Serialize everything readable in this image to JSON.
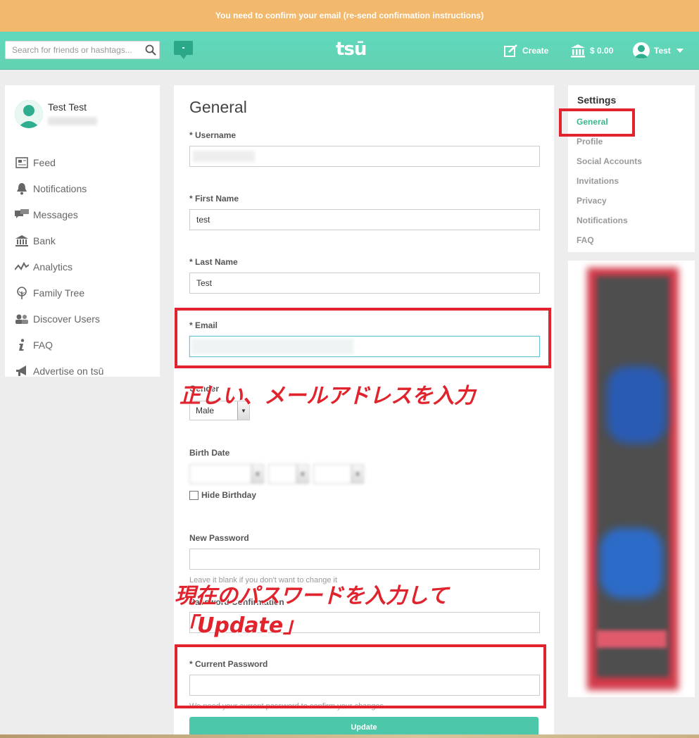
{
  "banner": {
    "text": "You need to confirm your email (re-send confirmation instructions)"
  },
  "topbar": {
    "search_placeholder": "Search for friends or hashtags...",
    "logo": "tsū",
    "create_label": "Create",
    "balance": "$ 0.00",
    "user_label": "Test"
  },
  "profile": {
    "name": "Test Test"
  },
  "sidebar": {
    "items": [
      {
        "label": "Feed",
        "icon": "newspaper-icon"
      },
      {
        "label": "Notifications",
        "icon": "bell-icon"
      },
      {
        "label": "Messages",
        "icon": "chat-bubbles-icon"
      },
      {
        "label": "Bank",
        "icon": "bank-icon"
      },
      {
        "label": "Analytics",
        "icon": "analytics-icon"
      },
      {
        "label": "Family Tree",
        "icon": "tree-icon"
      },
      {
        "label": "Discover Users",
        "icon": "users-icon"
      },
      {
        "label": "FAQ",
        "icon": "info-icon"
      },
      {
        "label": "Advertise on tsū",
        "icon": "megaphone-icon"
      }
    ]
  },
  "form": {
    "title": "General",
    "username_label": "* Username",
    "firstname_label": "* First Name",
    "firstname_value": "test",
    "lastname_label": "* Last Name",
    "lastname_value": "Test",
    "email_label": "* Email",
    "gender_label": "Gender",
    "gender_value": "Male",
    "birthdate_label": "Birth Date",
    "hide_birthday_label": "Hide Birthday",
    "new_password_label": "New Password",
    "new_password_hint": "Leave it blank if you don't want to change it",
    "password_confirm_label": "Password Confirmation",
    "current_password_label": "* Current Password",
    "current_password_hint": "We need your current password to confirm your changes",
    "update_label": "Update"
  },
  "settings": {
    "title": "Settings",
    "items": [
      "General",
      "Profile",
      "Social Accounts",
      "Invitations",
      "Privacy",
      "Notifications",
      "FAQ"
    ],
    "active": "General"
  },
  "annotations": {
    "email_note": "正しい、メールアドレスを入力",
    "password_note_line1": "現在のパスワードを入力して",
    "password_note_line2": "「Update」"
  },
  "colors": {
    "banner": "#f2b86c",
    "topbar": "#5fd8bd",
    "accent": "#4cc7a9",
    "annotation_red": "#e0232c"
  }
}
